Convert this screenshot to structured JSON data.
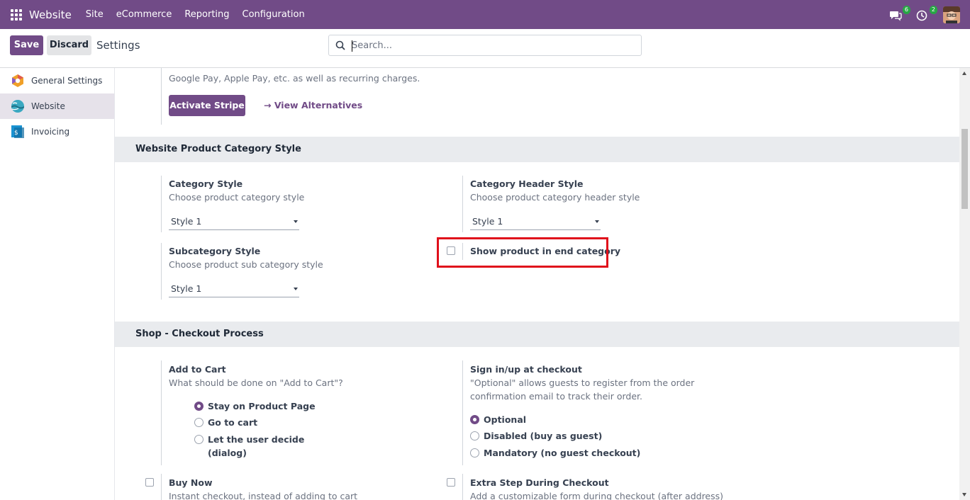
{
  "topbar": {
    "app_name": "Website",
    "menus": [
      "Site",
      "eCommerce",
      "Reporting",
      "Configuration"
    ],
    "messages_count": "6",
    "activities_count": "2",
    "color": "#714b87"
  },
  "control_panel": {
    "save_label": "Save",
    "discard_label": "Discard",
    "title": "Settings",
    "search_placeholder": "Search..."
  },
  "sidebar": {
    "items": [
      {
        "label": "General Settings",
        "icon": "odoo-settings-icon"
      },
      {
        "label": "Website",
        "icon": "website-icon",
        "active": true
      },
      {
        "label": "Invoicing",
        "icon": "invoicing-icon"
      }
    ]
  },
  "payment": {
    "desc_line": "Google Pay, Apple Pay, etc. as well as recurring charges.",
    "activate_label": "Activate Stripe",
    "alternatives_label": "View Alternatives"
  },
  "category_section": {
    "title": "Website Product Category Style",
    "category_style": {
      "label": "Category Style",
      "desc": "Choose product category style",
      "value": "Style 1"
    },
    "header_style": {
      "label": "Category Header Style",
      "desc": "Choose product category header style",
      "value": "Style 1"
    },
    "subcategory_style": {
      "label": "Subcategory Style",
      "desc": "Choose product sub category style",
      "value": "Style 1"
    },
    "end_category": {
      "label": "Show product in end category",
      "checked": false
    }
  },
  "checkout_section": {
    "title": "Shop - Checkout Process",
    "add_to_cart": {
      "label": "Add to Cart",
      "desc": "What should be done on \"Add to Cart\"?",
      "options": [
        "Stay on Product Page",
        "Go to cart",
        "Let the user decide",
        "(dialog)"
      ],
      "selected": "Stay on Product Page"
    },
    "signin": {
      "label": "Sign in/up at checkout",
      "desc_line1": "\"Optional\" allows guests to register from the order",
      "desc_line2": "confirmation email to track their order.",
      "options": [
        "Optional",
        "Disabled (buy as guest)",
        "Mandatory (no guest checkout)"
      ],
      "selected": "Optional"
    },
    "buy_now": {
      "label": "Buy Now",
      "desc": "Instant checkout, instead of adding to cart"
    },
    "extra_step": {
      "label": "Extra Step During Checkout",
      "desc": "Add a customizable form during checkout (after address)"
    }
  }
}
